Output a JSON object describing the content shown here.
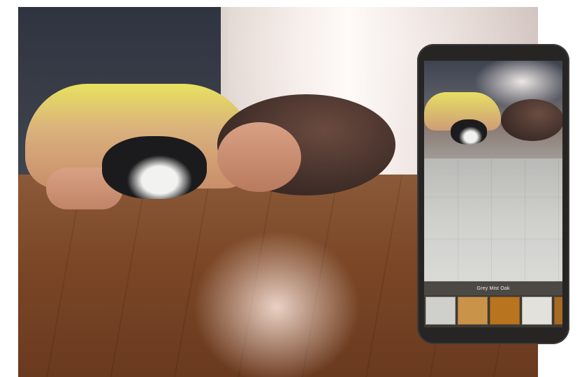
{
  "phone": {
    "product_name": "Grey Mist Oak",
    "swatches": [
      {
        "name": "grey-oak",
        "color": "#cfcfcc"
      },
      {
        "name": "honey-oak",
        "color": "#c9934a"
      },
      {
        "name": "amber-oak",
        "color": "#b9741f"
      },
      {
        "name": "white-oak",
        "color": "#e2e1dc"
      },
      {
        "name": "dark-amber-oak",
        "color": "#a56a24"
      }
    ]
  }
}
